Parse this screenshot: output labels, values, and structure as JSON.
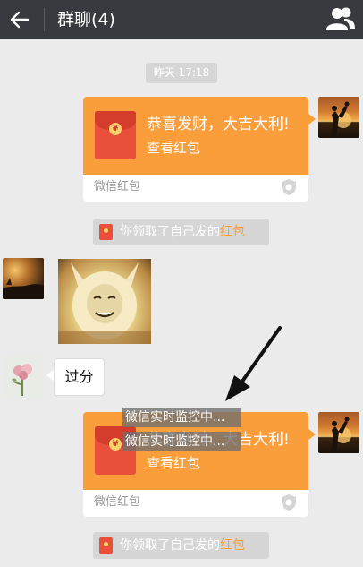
{
  "header": {
    "title": "群聊(4)",
    "back_icon": "arrow-left-icon",
    "members_icon": "two-people-icon",
    "background": "#393a3f"
  },
  "chat": {
    "timestamp": "昨天 17:18",
    "red_packets": [
      {
        "greeting": "恭喜发财，大吉大利!",
        "action": "查看红包",
        "brand": "微信红包"
      },
      {
        "greeting": "恭喜发财，大吉大利!",
        "action": "查看红包",
        "brand": "微信红包"
      }
    ],
    "notices": [
      {
        "prefix": "你领取了自己发的",
        "link": "红包"
      },
      {
        "prefix": "你领取了自己发的",
        "link": "红包"
      }
    ],
    "text_message": "过分",
    "overlay_lines": [
      "微信实时监控中...",
      "微信实时监控中..."
    ],
    "overlay_partial": "恭喜发财"
  },
  "colors": {
    "red_packet_orange": "#fa9d3b",
    "envelope_red": "#e94f3a",
    "chat_background": "#ebebeb",
    "notice_link": "#fa9d3b"
  }
}
